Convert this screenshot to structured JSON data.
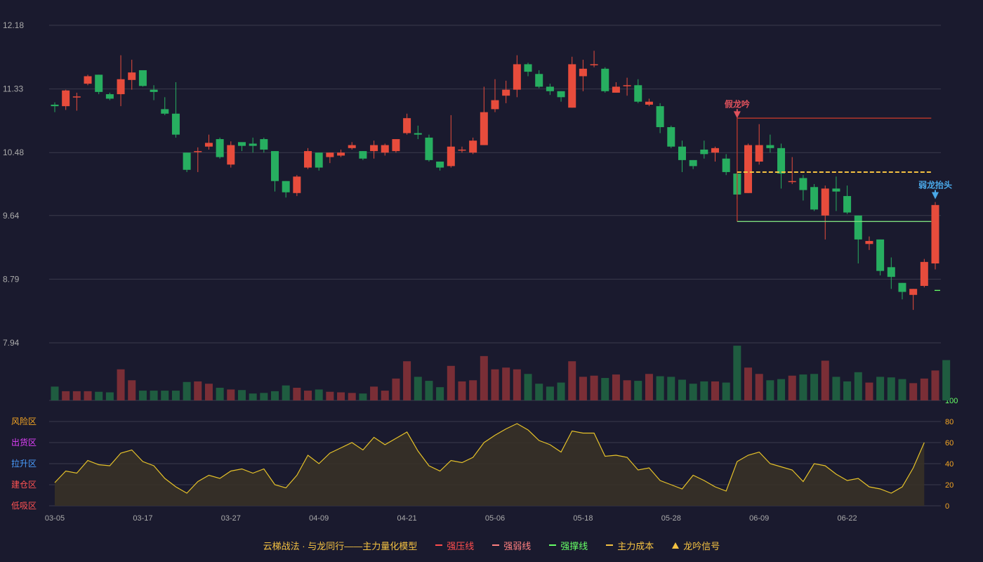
{
  "chart_data": {
    "type": "candlestick",
    "price_axis": {
      "labels": [
        "12.18",
        "11.33",
        "10.48",
        "9.64",
        "8.79",
        "7.94"
      ],
      "range": [
        7.94,
        12.18
      ]
    },
    "date_ticks": [
      "03-05",
      "03-17",
      "03-27",
      "04-09",
      "04-21",
      "05-06",
      "05-18",
      "05-28",
      "06-09",
      "06-22"
    ],
    "indicator_axis": {
      "right_labels": [
        "100",
        "80",
        "60",
        "40",
        "20",
        "0"
      ],
      "left_zones": [
        {
          "label": "风险区",
          "color": "#f5a623"
        },
        {
          "label": "出货区",
          "color": "#e040fb"
        },
        {
          "label": "拉升区",
          "color": "#4a9eff"
        },
        {
          "label": "建仓区",
          "color": "#ff5252"
        },
        {
          "label": "低吸区",
          "color": "#ff5252"
        }
      ],
      "range": [
        0,
        100
      ]
    },
    "candles": [
      [
        11.12,
        11.1,
        11.15,
        11.02
      ],
      [
        11.1,
        11.31,
        11.32,
        11.05
      ],
      [
        11.22,
        11.23,
        11.28,
        11.04
      ],
      [
        11.4,
        11.5,
        11.52,
        11.38
      ],
      [
        11.52,
        11.29,
        11.52,
        11.26
      ],
      [
        11.26,
        11.2,
        11.28,
        11.18
      ],
      [
        11.26,
        11.46,
        11.78,
        11.1
      ],
      [
        11.45,
        11.55,
        11.72,
        11.32
      ],
      [
        11.58,
        11.37,
        11.58,
        11.36
      ],
      [
        11.32,
        11.29,
        11.38,
        11.18
      ],
      [
        11.06,
        11.0,
        11.22,
        10.98
      ],
      [
        11.0,
        10.72,
        11.42,
        10.68
      ],
      [
        10.48,
        10.25,
        10.48,
        10.22
      ],
      [
        10.5,
        10.5,
        10.55,
        10.22
      ],
      [
        10.56,
        10.61,
        10.72,
        10.52
      ],
      [
        10.66,
        10.42,
        10.68,
        10.4
      ],
      [
        10.32,
        10.58,
        10.63,
        10.28
      ],
      [
        10.62,
        10.57,
        10.6,
        10.5
      ],
      [
        10.6,
        10.57,
        10.68,
        10.48
      ],
      [
        10.66,
        10.52,
        10.68,
        10.48
      ],
      [
        10.5,
        10.1,
        10.5,
        9.96
      ],
      [
        10.1,
        9.95,
        10.1,
        9.88
      ],
      [
        9.94,
        10.16,
        10.18,
        9.9
      ],
      [
        10.28,
        10.5,
        10.54,
        10.26
      ],
      [
        10.48,
        10.28,
        10.48,
        10.24
      ],
      [
        10.42,
        10.48,
        10.48,
        10.34
      ],
      [
        10.44,
        10.48,
        10.52,
        10.42
      ],
      [
        10.54,
        10.58,
        10.62,
        10.52
      ],
      [
        10.5,
        10.4,
        10.5,
        10.38
      ],
      [
        10.5,
        10.58,
        10.64,
        10.4
      ],
      [
        10.48,
        10.58,
        10.6,
        10.44
      ],
      [
        10.5,
        10.66,
        10.66,
        10.48
      ],
      [
        10.74,
        10.94,
        11.0,
        10.72
      ],
      [
        10.74,
        10.72,
        10.84,
        10.66
      ],
      [
        10.68,
        10.38,
        10.72,
        10.36
      ],
      [
        10.36,
        10.28,
        10.36,
        10.24
      ],
      [
        10.3,
        10.56,
        10.98,
        10.28
      ],
      [
        10.52,
        10.52,
        10.56,
        10.48
      ],
      [
        10.48,
        10.64,
        10.68,
        10.46
      ],
      [
        10.58,
        11.02,
        11.36,
        10.58
      ],
      [
        11.06,
        11.18,
        11.46,
        11.02
      ],
      [
        11.24,
        11.32,
        11.44,
        11.14
      ],
      [
        11.32,
        11.66,
        11.78,
        11.22
      ],
      [
        11.66,
        11.56,
        11.68,
        11.5
      ],
      [
        11.53,
        11.36,
        11.58,
        11.34
      ],
      [
        11.36,
        11.3,
        11.4,
        11.25
      ],
      [
        11.3,
        11.22,
        11.3,
        11.16
      ],
      [
        11.08,
        11.66,
        11.76,
        11.08
      ],
      [
        11.5,
        11.6,
        11.72,
        11.3
      ],
      [
        11.66,
        11.66,
        11.84,
        11.62
      ],
      [
        11.6,
        11.3,
        11.62,
        11.28
      ],
      [
        11.28,
        11.36,
        11.42,
        11.28
      ],
      [
        11.38,
        11.38,
        11.48,
        11.24
      ],
      [
        11.38,
        11.16,
        11.46,
        11.14
      ],
      [
        11.12,
        11.16,
        11.2,
        11.1
      ],
      [
        11.1,
        10.82,
        11.14,
        10.74
      ],
      [
        10.82,
        10.56,
        10.84,
        10.54
      ],
      [
        10.56,
        10.38,
        10.64,
        10.22
      ],
      [
        10.38,
        10.3,
        10.38,
        10.26
      ],
      [
        10.52,
        10.46,
        10.64,
        10.4
      ],
      [
        10.48,
        10.54,
        10.56,
        10.36
      ],
      [
        10.4,
        10.22,
        10.46,
        10.18
      ],
      [
        10.2,
        9.92,
        10.2,
        9.86
      ],
      [
        9.94,
        10.58,
        10.6,
        9.94
      ],
      [
        10.36,
        10.58,
        10.86,
        10.32
      ],
      [
        10.58,
        10.54,
        10.72,
        10.48
      ],
      [
        10.54,
        10.2,
        10.6,
        10.0
      ],
      [
        10.1,
        10.1,
        10.42,
        10.06
      ],
      [
        10.14,
        9.98,
        10.18,
        9.84
      ],
      [
        10.02,
        9.72,
        10.06,
        9.7
      ],
      [
        9.64,
        10.0,
        10.04,
        9.32
      ],
      [
        10.0,
        9.96,
        10.16,
        9.7
      ],
      [
        9.9,
        9.68,
        10.04,
        9.66
      ],
      [
        9.64,
        9.32,
        9.64,
        9.0
      ],
      [
        9.26,
        9.3,
        9.36,
        9.18
      ],
      [
        9.32,
        8.9,
        9.32,
        8.84
      ],
      [
        8.95,
        8.82,
        9.08,
        8.66
      ],
      [
        8.74,
        8.62,
        8.74,
        8.52
      ],
      [
        8.58,
        8.66,
        8.66,
        8.38
      ],
      [
        8.7,
        9.02,
        9.06,
        8.68
      ],
      [
        9.0,
        9.78,
        9.82,
        8.92
      ]
    ],
    "volume": [
      24,
      16,
      16,
      16,
      15,
      14,
      54,
      35,
      17,
      17,
      17,
      17,
      32,
      33,
      29,
      22,
      19,
      18,
      12,
      13,
      16,
      26,
      22,
      17,
      19,
      15,
      14,
      13,
      12,
      24,
      17,
      38,
      68,
      41,
      34,
      23,
      60,
      33,
      35,
      77,
      54,
      57,
      54,
      46,
      29,
      24,
      31,
      68,
      41,
      43,
      39,
      45,
      35,
      34,
      46,
      42,
      41,
      36,
      29,
      33,
      33,
      31,
      95,
      57,
      46,
      35,
      37,
      43,
      45,
      46,
      69,
      41,
      33,
      49,
      31,
      41,
      40,
      37,
      30,
      38,
      52,
      70
    ],
    "indicator": [
      22,
      33,
      31,
      43,
      39,
      38,
      50,
      53,
      42,
      38,
      26,
      18,
      12,
      23,
      29,
      26,
      33,
      35,
      31,
      35,
      20,
      17,
      29,
      48,
      40,
      50,
      55,
      60,
      53,
      65,
      58,
      64,
      70,
      52,
      38,
      33,
      43,
      41,
      46,
      60,
      67,
      73,
      78,
      72,
      62,
      58,
      51,
      71,
      69,
      69,
      47,
      48,
      46,
      34,
      36,
      24,
      20,
      16,
      29,
      24,
      18,
      14,
      42,
      48,
      51,
      40,
      37,
      34,
      23,
      40,
      38,
      30,
      24,
      26,
      18,
      16,
      12,
      18,
      36,
      60
    ],
    "annotations": [
      {
        "text": "假龙吟",
        "index": 62,
        "value": 10.92,
        "color": "#e0525c"
      },
      {
        "text": "弱龙抬头",
        "index": 80,
        "value": 9.84,
        "color": "#4aa8e8"
      }
    ],
    "levels": {
      "strong_pressure": {
        "value": 10.94,
        "from": 62,
        "to": 79,
        "color": "#c0392b"
      },
      "strong_support": {
        "value": 9.56,
        "from": 62,
        "to": 79,
        "color": "#7ddc7d"
      },
      "cost_line": {
        "value": 10.22,
        "from": 62,
        "to": 79,
        "color": "#f5c242"
      }
    },
    "legend": [
      {
        "label": "云梯战法 · 与龙同行——主力量化模型",
        "symbol": "none",
        "color": "#f5c242"
      },
      {
        "label": "强压线",
        "symbol": "line",
        "color": "#ff4d4d"
      },
      {
        "label": "强弱线",
        "symbol": "dash",
        "color": "#ff8080"
      },
      {
        "label": "强撑线",
        "symbol": "line",
        "color": "#66ff66"
      },
      {
        "label": "主力成本",
        "symbol": "dash",
        "color": "#f5c242"
      },
      {
        "label": "龙吟信号",
        "symbol": "triangle",
        "color": "#f5c242"
      }
    ],
    "colors": {
      "up": "#e74c3c",
      "down": "#27ae60",
      "vol_up": "#7a2e36",
      "vol_down": "#1f5c40",
      "grid": "#3a3a4c",
      "indicator_line": "#e6c229"
    }
  }
}
